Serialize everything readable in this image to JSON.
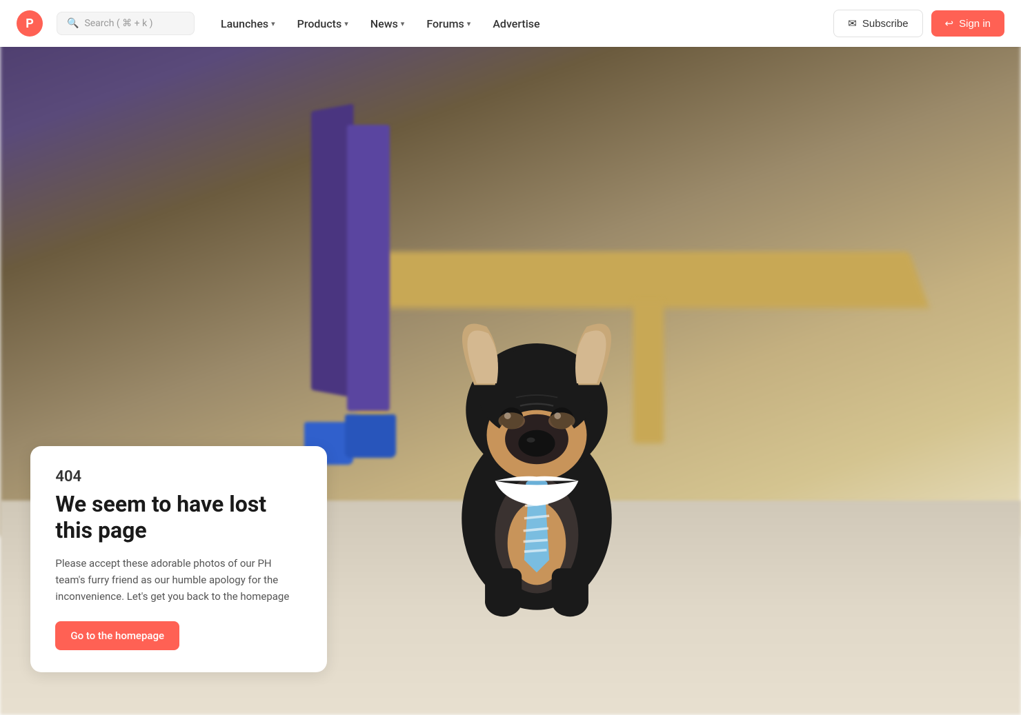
{
  "brand": {
    "logo_letter": "P",
    "logo_color": "#ff6154"
  },
  "navbar": {
    "search_placeholder": "Search ( ⌘ + k )",
    "nav_items": [
      {
        "label": "Launches",
        "has_dropdown": true
      },
      {
        "label": "Products",
        "has_dropdown": true
      },
      {
        "label": "News",
        "has_dropdown": true
      },
      {
        "label": "Forums",
        "has_dropdown": true
      },
      {
        "label": "Advertise",
        "has_dropdown": false
      }
    ],
    "subscribe_label": "Subscribe",
    "signin_label": "Sign in"
  },
  "error_page": {
    "code": "404",
    "title": "We seem to have lost this page",
    "description": "Please accept these adorable photos of our PH team's furry friend as our humble apology for the inconvenience. Let's get you back to the homepage",
    "cta_label": "Go to the homepage"
  }
}
